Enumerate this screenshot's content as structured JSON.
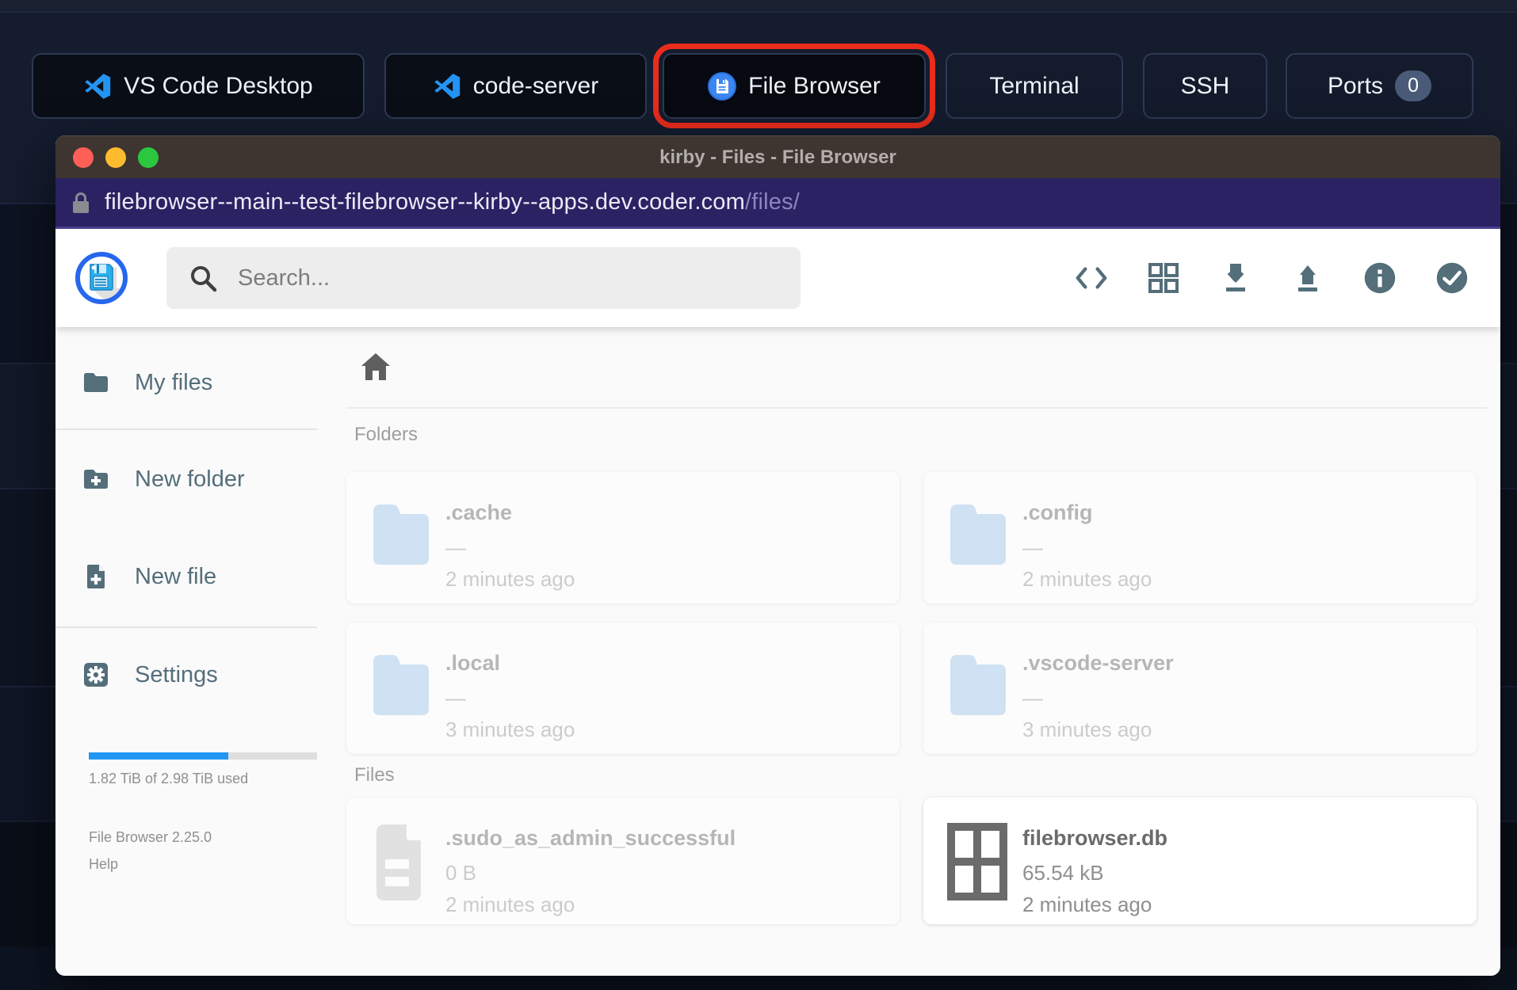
{
  "taskbar": {
    "apps": [
      {
        "label": "VS Code Desktop",
        "icon": "vscode"
      },
      {
        "label": "code-server",
        "icon": "vscode"
      },
      {
        "label": "File Browser",
        "icon": "filebrowser",
        "highlighted": true
      },
      {
        "label": "Terminal"
      },
      {
        "label": "SSH"
      },
      {
        "label": "Ports",
        "badge": "0"
      }
    ]
  },
  "window": {
    "title": "kirby - Files - File Browser",
    "url": {
      "host": "filebrowser--main--test-filebrowser--kirby--apps.dev.coder.com",
      "path": "/files/"
    }
  },
  "header": {
    "search_placeholder": "Search...",
    "toolbar_icons": [
      "code-view",
      "grid-view",
      "download",
      "upload",
      "info",
      "select"
    ]
  },
  "sidebar": {
    "items": [
      {
        "label": "My files",
        "icon": "folder"
      },
      {
        "label": "New folder",
        "icon": "folder-plus"
      },
      {
        "label": "New file",
        "icon": "file-plus"
      },
      {
        "label": "Settings",
        "icon": "settings"
      }
    ],
    "usage": {
      "text": "1.82 TiB of 2.98 TiB used",
      "percent": 61,
      "fill_style": "width:61%"
    },
    "version": "File Browser 2.25.0",
    "help_label": "Help"
  },
  "listing": {
    "folders_header": "Folders",
    "files_header": "Files",
    "folders": [
      {
        "name": ".cache",
        "size": "—",
        "time": "2 minutes ago",
        "hidden": true
      },
      {
        "name": ".config",
        "size": "—",
        "time": "2 minutes ago",
        "hidden": true
      },
      {
        "name": ".local",
        "size": "—",
        "time": "3 minutes ago",
        "hidden": true
      },
      {
        "name": ".vscode-server",
        "size": "—",
        "time": "3 minutes ago",
        "hidden": true
      }
    ],
    "files": [
      {
        "name": ".sudo_as_admin_successful",
        "size": "0 B",
        "time": "2 minutes ago",
        "hidden": true
      },
      {
        "name": "filebrowser.db",
        "size": "65.54 kB",
        "time": "2 minutes ago",
        "hidden": false
      }
    ]
  },
  "colors": {
    "highlight_ring": "#e92c1c",
    "accent_blue": "#2196f3",
    "folder_icon_blue": "#a5cbee",
    "toolbar_icon_slate": "#546e7a",
    "url_bar": "#2b2264",
    "title_bar": "#3e3531",
    "traffic_red": "#fe5f57",
    "traffic_yellow": "#febb2e",
    "traffic_green": "#2bc83f"
  }
}
